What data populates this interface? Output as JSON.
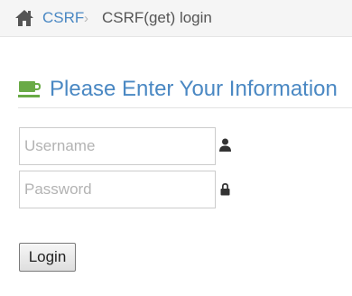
{
  "breadcrumb": {
    "home_icon": "home-icon",
    "link_label": "CSRF",
    "separator": "›",
    "current_label": "CSRF(get) login"
  },
  "heading": {
    "icon": "coffee-icon",
    "title": "Please Enter Your Information"
  },
  "form": {
    "username": {
      "placeholder": "Username",
      "value": "",
      "icon": "user-icon"
    },
    "password": {
      "placeholder": "Password",
      "value": "",
      "icon": "lock-icon"
    },
    "submit_label": "Login"
  },
  "colors": {
    "accent": "#4a88c3",
    "coffee_green": "#69aa46",
    "breadcrumb_bg": "#f5f5f5"
  }
}
